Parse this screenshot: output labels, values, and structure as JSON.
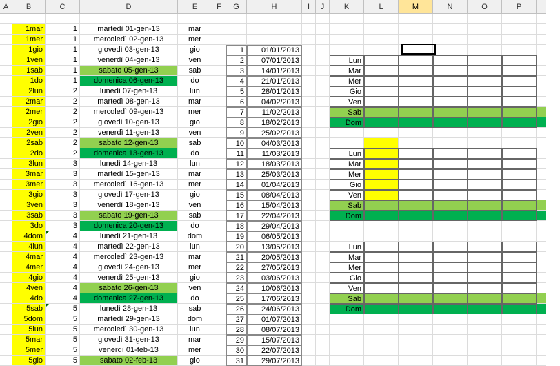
{
  "columns": [
    "A",
    "B",
    "C",
    "D",
    "E",
    "F",
    "G",
    "H",
    "I",
    "J",
    "K",
    "L",
    "M",
    "N",
    "O",
    "P",
    ""
  ],
  "selected_col": "M",
  "rows": [
    {
      "b": "1mar",
      "c": "1",
      "d": "martedì 01-gen-13",
      "e": "mar",
      "g": "",
      "h": "",
      "k": "",
      "hl_b": "yellow"
    },
    {
      "b": "1mer",
      "c": "1",
      "d": "mercoledì 02-gen-13",
      "e": "mer",
      "g": "",
      "h": "",
      "k": "",
      "hl_b": "yellow"
    },
    {
      "b": "1gio",
      "c": "1",
      "d": "giovedì 03-gen-13",
      "e": "gio",
      "g": "1",
      "h": "01/01/2013",
      "k": "",
      "hl_b": "yellow"
    },
    {
      "b": "1ven",
      "c": "1",
      "d": "venerdì 04-gen-13",
      "e": "ven",
      "g": "2",
      "h": "07/01/2013",
      "k": "Lun",
      "hl_b": "yellow",
      "block": 1
    },
    {
      "b": "1sab",
      "c": "1",
      "d": "sabato 05-gen-13",
      "e": "sab",
      "g": "3",
      "h": "14/01/2013",
      "k": "Mar",
      "hl_b": "yellow",
      "hl_d": "lightgreen",
      "block": 1
    },
    {
      "b": "1do",
      "c": "1",
      "d": "domenica 06-gen-13",
      "e": "do",
      "g": "4",
      "h": "21/01/2013",
      "k": "Mer",
      "hl_b": "yellow",
      "hl_d": "darkgreen",
      "block": 1
    },
    {
      "b": "2lun",
      "c": "2",
      "d": "lunedì 07-gen-13",
      "e": "lun",
      "g": "5",
      "h": "28/01/2013",
      "k": "Gio",
      "hl_b": "yellow",
      "block": 1
    },
    {
      "b": "2mar",
      "c": "2",
      "d": "martedì 08-gen-13",
      "e": "mar",
      "g": "6",
      "h": "04/02/2013",
      "k": "Ven",
      "hl_b": "yellow",
      "block": 1
    },
    {
      "b": "2mer",
      "c": "2",
      "d": "mercoledì 09-gen-13",
      "e": "mer",
      "g": "7",
      "h": "11/02/2013",
      "k": "Sab",
      "hl_b": "yellow",
      "hl_k": "lightgreen",
      "block": 1,
      "block_fill": "lightgreen"
    },
    {
      "b": "2gio",
      "c": "2",
      "d": "giovedì 10-gen-13",
      "e": "gio",
      "g": "8",
      "h": "18/02/2013",
      "k": "Dom",
      "hl_b": "yellow",
      "hl_k": "darkgreen",
      "block": 1,
      "block_fill": "darkgreen"
    },
    {
      "b": "2ven",
      "c": "2",
      "d": "venerdì 11-gen-13",
      "e": "ven",
      "g": "9",
      "h": "25/02/2013",
      "k": "",
      "hl_b": "yellow"
    },
    {
      "b": "2sab",
      "c": "2",
      "d": "sabato 12-gen-13",
      "e": "sab",
      "g": "10",
      "h": "04/03/2013",
      "k": "",
      "hl_b": "yellow",
      "hl_d": "lightgreen",
      "l_fill": "yellow"
    },
    {
      "b": "2do",
      "c": "2",
      "d": "domenica 13-gen-13",
      "e": "do",
      "g": "11",
      "h": "11/03/2013",
      "k": "Lun",
      "hl_b": "yellow",
      "hl_d": "darkgreen",
      "block": 2,
      "l_fill": "yellow"
    },
    {
      "b": "3lun",
      "c": "3",
      "d": "lunedì 14-gen-13",
      "e": "lun",
      "g": "12",
      "h": "18/03/2013",
      "k": "Mar",
      "hl_b": "yellow",
      "block": 2,
      "l_fill": "yellow"
    },
    {
      "b": "3mar",
      "c": "3",
      "d": "martedì 15-gen-13",
      "e": "mar",
      "g": "13",
      "h": "25/03/2013",
      "k": "Mer",
      "hl_b": "yellow",
      "block": 2,
      "l_fill": "yellow"
    },
    {
      "b": "3mer",
      "c": "3",
      "d": "mercoledì 16-gen-13",
      "e": "mer",
      "g": "14",
      "h": "01/04/2013",
      "k": "Gio",
      "hl_b": "yellow",
      "block": 2,
      "l_fill": "yellow"
    },
    {
      "b": "3gio",
      "c": "3",
      "d": "giovedì 17-gen-13",
      "e": "gio",
      "g": "15",
      "h": "08/04/2013",
      "k": "Ven",
      "hl_b": "yellow",
      "block": 2,
      "l_fill": "yellow"
    },
    {
      "b": "3ven",
      "c": "3",
      "d": "venerdì 18-gen-13",
      "e": "ven",
      "g": "16",
      "h": "15/04/2013",
      "k": "Sab",
      "hl_b": "yellow",
      "hl_k": "lightgreen",
      "block": 2,
      "block_fill": "lightgreen"
    },
    {
      "b": "3sab",
      "c": "3",
      "d": "sabato 19-gen-13",
      "e": "sab",
      "g": "17",
      "h": "22/04/2013",
      "k": "Dom",
      "hl_b": "yellow",
      "hl_d": "lightgreen",
      "hl_k": "darkgreen",
      "block": 2,
      "block_fill": "darkgreen"
    },
    {
      "b": "3do",
      "c": "3",
      "d": "domenica 20-gen-13",
      "e": "do",
      "g": "18",
      "h": "29/04/2013",
      "k": "",
      "hl_b": "yellow",
      "hl_d": "darkgreen"
    },
    {
      "b": "4dom",
      "c": "4",
      "d": "lunedì 21-gen-13",
      "e": "dom",
      "g": "19",
      "h": "06/05/2013",
      "k": "",
      "hl_b": "yellow",
      "tri": true
    },
    {
      "b": "4lun",
      "c": "4",
      "d": "martedì 22-gen-13",
      "e": "lun",
      "g": "20",
      "h": "13/05/2013",
      "k": "Lun",
      "hl_b": "yellow",
      "block": 3
    },
    {
      "b": "4mar",
      "c": "4",
      "d": "mercoledì 23-gen-13",
      "e": "mar",
      "g": "21",
      "h": "20/05/2013",
      "k": "Mar",
      "hl_b": "yellow",
      "block": 3
    },
    {
      "b": "4mer",
      "c": "4",
      "d": "giovedì 24-gen-13",
      "e": "mer",
      "g": "22",
      "h": "27/05/2013",
      "k": "Mer",
      "hl_b": "yellow",
      "block": 3
    },
    {
      "b": "4gio",
      "c": "4",
      "d": "venerdì 25-gen-13",
      "e": "gio",
      "g": "23",
      "h": "03/06/2013",
      "k": "Gio",
      "hl_b": "yellow",
      "block": 3
    },
    {
      "b": "4ven",
      "c": "4",
      "d": "sabato 26-gen-13",
      "e": "ven",
      "g": "24",
      "h": "10/06/2013",
      "k": "Ven",
      "hl_b": "yellow",
      "hl_d": "lightgreen",
      "block": 3
    },
    {
      "b": "4do",
      "c": "4",
      "d": "domenica 27-gen-13",
      "e": "do",
      "g": "25",
      "h": "17/06/2013",
      "k": "Sab",
      "hl_b": "yellow",
      "hl_d": "darkgreen",
      "hl_k": "lightgreen",
      "block": 3,
      "block_fill": "lightgreen"
    },
    {
      "b": "5sab",
      "c": "5",
      "d": "lunedì 28-gen-13",
      "e": "sab",
      "g": "26",
      "h": "24/06/2013",
      "k": "Dom",
      "hl_b": "yellow",
      "hl_k": "darkgreen",
      "block": 3,
      "block_fill": "darkgreen",
      "tri": true
    },
    {
      "b": "5dom",
      "c": "5",
      "d": "martedì 29-gen-13",
      "e": "dom",
      "g": "27",
      "h": "01/07/2013",
      "k": "",
      "hl_b": "yellow"
    },
    {
      "b": "5lun",
      "c": "5",
      "d": "mercoledì 30-gen-13",
      "e": "lun",
      "g": "28",
      "h": "08/07/2013",
      "k": "",
      "hl_b": "yellow"
    },
    {
      "b": "5mar",
      "c": "5",
      "d": "giovedì 31-gen-13",
      "e": "mar",
      "g": "29",
      "h": "15/07/2013",
      "k": "",
      "hl_b": "yellow"
    },
    {
      "b": "5mer",
      "c": "5",
      "d": "venerdì 01-feb-13",
      "e": "mer",
      "g": "30",
      "h": "22/07/2013",
      "k": "",
      "hl_b": "yellow"
    },
    {
      "b": "5gio",
      "c": "5",
      "d": "sabato 02-feb-13",
      "e": "gio",
      "g": "31",
      "h": "29/07/2013",
      "k": "",
      "hl_b": "yellow",
      "hl_d": "lightgreen"
    }
  ]
}
